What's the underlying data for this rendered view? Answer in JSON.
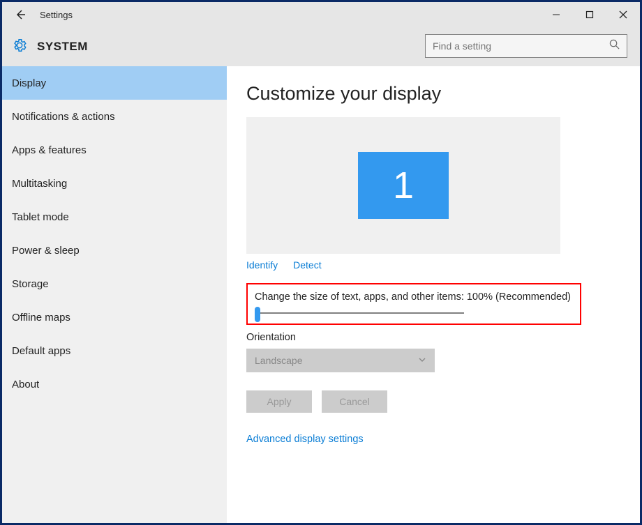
{
  "titlebar": {
    "title": "Settings"
  },
  "header": {
    "system_label": "SYSTEM"
  },
  "search": {
    "placeholder": "Find a setting"
  },
  "sidebar": {
    "items": [
      {
        "label": "Display",
        "selected": true
      },
      {
        "label": "Notifications & actions",
        "selected": false
      },
      {
        "label": "Apps & features",
        "selected": false
      },
      {
        "label": "Multitasking",
        "selected": false
      },
      {
        "label": "Tablet mode",
        "selected": false
      },
      {
        "label": "Power & sleep",
        "selected": false
      },
      {
        "label": "Storage",
        "selected": false
      },
      {
        "label": "Offline maps",
        "selected": false
      },
      {
        "label": "Default apps",
        "selected": false
      },
      {
        "label": "About",
        "selected": false
      }
    ]
  },
  "main": {
    "title": "Customize your display",
    "monitor_number": "1",
    "links": {
      "identify": "Identify",
      "detect": "Detect"
    },
    "scale_label": "Change the size of text, apps, and other items: 100% (Recommended)",
    "scale_value_percent": 100,
    "orientation_label": "Orientation",
    "orientation_value": "Landscape",
    "apply_label": "Apply",
    "cancel_label": "Cancel",
    "advanced_link": "Advanced display settings"
  },
  "colors": {
    "accent": "#3399ef",
    "link": "#0a7dd5",
    "highlight_border": "#ff0000"
  }
}
